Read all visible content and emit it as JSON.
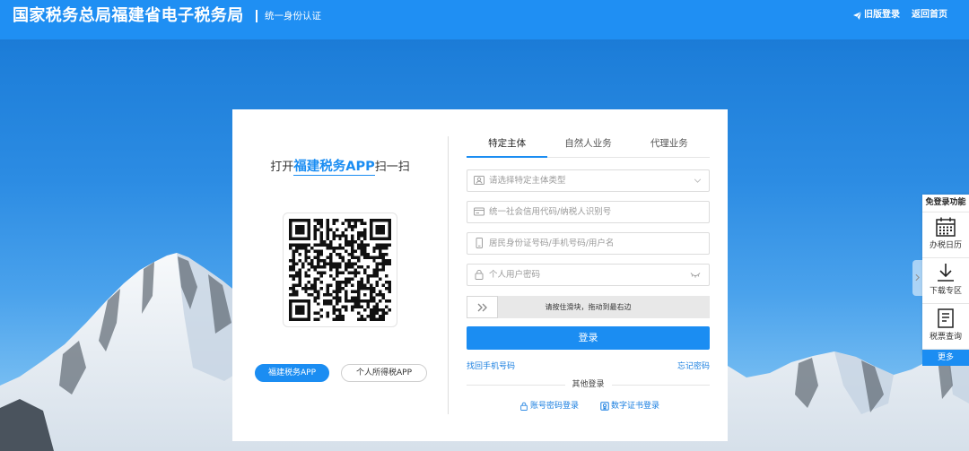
{
  "header": {
    "title": "国家税务总局福建省电子税务局",
    "subtitle": "统一身份认证",
    "old_login": "旧版登录",
    "home": "返回首页"
  },
  "qr_login": {
    "prompt_prefix": "打开",
    "prompt_app": "福建税务APP",
    "prompt_suffix": "扫一扫",
    "app_buttons": [
      {
        "label": "福建税务APP",
        "active": true
      },
      {
        "label": "个人所得税APP",
        "active": false
      }
    ]
  },
  "tabs": [
    {
      "label": "特定主体",
      "active": true
    },
    {
      "label": "自然人业务",
      "active": false
    },
    {
      "label": "代理业务",
      "active": false
    }
  ],
  "form": {
    "entity_type": {
      "placeholder": "请选择特定主体类型",
      "icon": "user-card-icon"
    },
    "credit_code": {
      "placeholder": "统一社会信用代码/纳税人识别号",
      "value": "",
      "icon": "id-card-icon"
    },
    "account": {
      "placeholder": "居民身份证号码/手机号码/用户名",
      "value": "",
      "icon": "phone-icon"
    },
    "password": {
      "placeholder": "个人用户密码",
      "value": "",
      "icon": "lock-icon"
    },
    "slider_text": "请按住滑块，拖动到最右边",
    "slider_progress": 0,
    "submit_label": "登录",
    "recover_phone": "找回手机号码",
    "forgot_password": "忘记密码"
  },
  "other_login": {
    "title": "其他登录",
    "options": [
      {
        "label": "账号密码登录",
        "icon": "lock-icon"
      },
      {
        "label": "数字证书登录",
        "icon": "certificate-icon"
      }
    ]
  },
  "side_panel": {
    "title": "免登录功能",
    "items": [
      {
        "label": "办税日历",
        "icon": "calendar-icon"
      },
      {
        "label": "下载专区",
        "icon": "download-icon"
      },
      {
        "label": "税票查询",
        "icon": "document-icon"
      }
    ],
    "more": "更多"
  },
  "colors": {
    "header": "#1f8ff3",
    "primary": "#1b8df2",
    "link": "#1a7fe0",
    "text": "#333333",
    "placeholder": "#9a9a9a"
  }
}
